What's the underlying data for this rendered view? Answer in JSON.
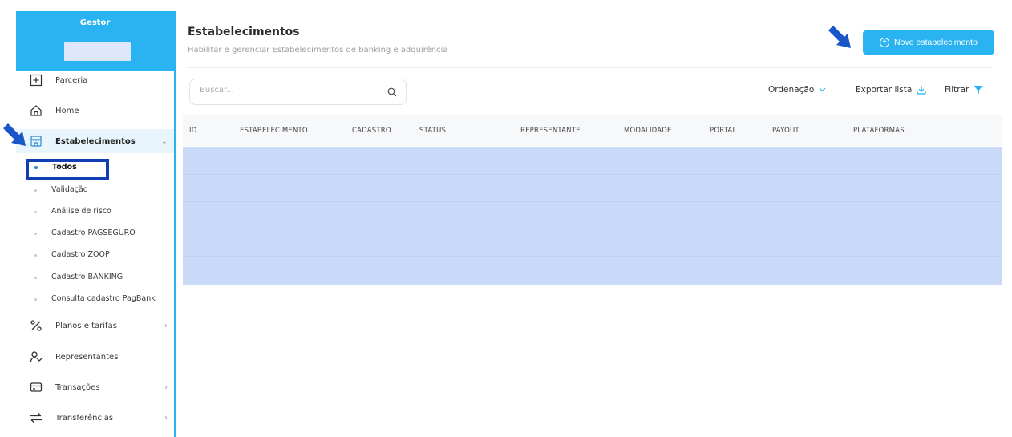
{
  "sidebar": {
    "title": "Gestor",
    "items": [
      {
        "label": "Parceria",
        "icon": "plus-square-icon"
      },
      {
        "label": "Home",
        "icon": "home-icon"
      },
      {
        "label": "Estabelecimentos",
        "icon": "store-icon",
        "expanded": true
      },
      {
        "label": "Planos e tarifas",
        "icon": "percent-icon"
      },
      {
        "label": "Representantes",
        "icon": "user-check-icon"
      },
      {
        "label": "Transações",
        "icon": "credit-card-icon"
      },
      {
        "label": "Transferências",
        "icon": "arrows-swap-icon"
      }
    ],
    "subitems": [
      {
        "label": "Todos",
        "selected": true
      },
      {
        "label": "Validação"
      },
      {
        "label": "Análise de risco"
      },
      {
        "label": "Cadastro PAGSEGURO"
      },
      {
        "label": "Cadastro ZOOP"
      },
      {
        "label": "Cadastro BANKING"
      },
      {
        "label": "Consulta cadastro PagBank"
      }
    ]
  },
  "header": {
    "title": "Estabelecimentos",
    "subtitle": "Habilitar e gerenciar Estabelecimentos de banking e adquirência",
    "new_button": "Novo estabelecimento"
  },
  "toolbar": {
    "search_placeholder": "Buscar...",
    "sort_label": "Ordenação",
    "export_label": "Exportar lista",
    "filter_label": "Filtrar"
  },
  "table": {
    "columns": [
      "ID",
      "ESTABELECIMENTO",
      "CADASTRO",
      "STATUS",
      "REPRESENTANTE",
      "MODALIDADE",
      "PORTAL",
      "PAYOUT",
      "PLATAFORMAS"
    ]
  },
  "colors": {
    "accent": "#29b3f0",
    "highlight": "#0f3fb3",
    "arrow": "#1a56c7",
    "rows_overlay": "#c9daf8"
  }
}
